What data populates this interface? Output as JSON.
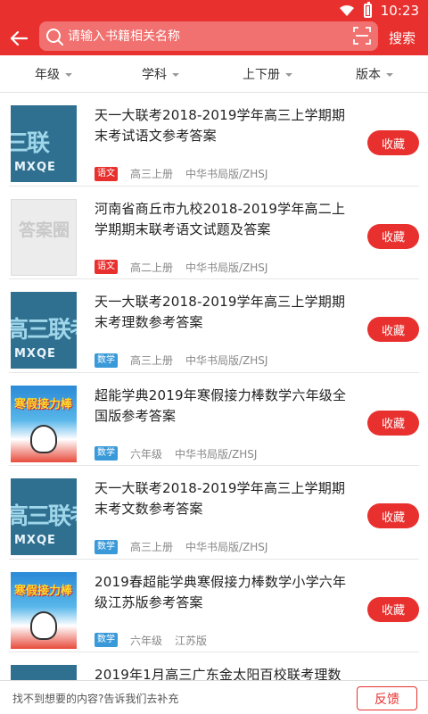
{
  "status_bar": {
    "time": "10:23"
  },
  "header": {
    "search_placeholder": "请输入书籍相关名称",
    "search_button": "搜索"
  },
  "filters": [
    "年级",
    "学科",
    "上下册",
    "版本"
  ],
  "items": [
    {
      "title": "天一大联考2018-2019学年高三上学期期末考试语文参考答案",
      "subject": "语文",
      "subject_color": "#e8312f",
      "grade": "高三上册",
      "publisher": "中华书局版/ZHSJ",
      "cover_type": "lianke",
      "cover_text": "三联",
      "cover_sub": "MXQE",
      "fav": "收藏"
    },
    {
      "title": "河南省商丘市九校2018-2019学年高二上学期期末联考语文试题及答案",
      "subject": "语文",
      "subject_color": "#e8312f",
      "grade": "高二上册",
      "publisher": "中华书局版/ZHSJ",
      "cover_type": "daan",
      "cover_text": "答案圈",
      "fav": "收藏"
    },
    {
      "title": "天一大联考2018-2019学年高三上学期期末考理数参考答案",
      "subject": "数学",
      "subject_color": "#3a9ad9",
      "grade": "高三上册",
      "publisher": "中华书局版/ZHSJ",
      "cover_type": "lianke",
      "cover_text": "高三联考",
      "cover_sub": "MXQE",
      "fav": "收藏"
    },
    {
      "title": "超能学典2019年寒假接力棒数学六年级全国版参考答案",
      "subject": "数学",
      "subject_color": "#3a9ad9",
      "grade": "六年级",
      "publisher": "中华书局版/ZHSJ",
      "cover_type": "winter",
      "cover_text": "寒假接力棒",
      "fav": "收藏"
    },
    {
      "title": "天一大联考2018-2019学年高三上学期期末考文数参考答案",
      "subject": "数学",
      "subject_color": "#3a9ad9",
      "grade": "高三上册",
      "publisher": "中华书局版/ZHSJ",
      "cover_type": "lianke",
      "cover_text": "高三联考",
      "cover_sub": "MXQE",
      "fav": "收藏"
    },
    {
      "title": "2019春超能学典寒假接力棒数学小学六年级江苏版参考答案",
      "subject": "数学",
      "subject_color": "#3a9ad9",
      "grade": "六年级",
      "publisher": "江苏版",
      "cover_type": "winter",
      "cover_text": "寒假接力棒",
      "fav": "收藏"
    },
    {
      "title": "2019年1月高三广东金太阳百校联考理数",
      "subject": "",
      "subject_color": "#3a9ad9",
      "grade": "",
      "publisher": "",
      "cover_type": "lianke",
      "cover_text": "",
      "cover_sub": "",
      "fav": ""
    }
  ],
  "bottom": {
    "text": "找不到想要的内容?告诉我们去补充",
    "feedback": "反馈"
  }
}
